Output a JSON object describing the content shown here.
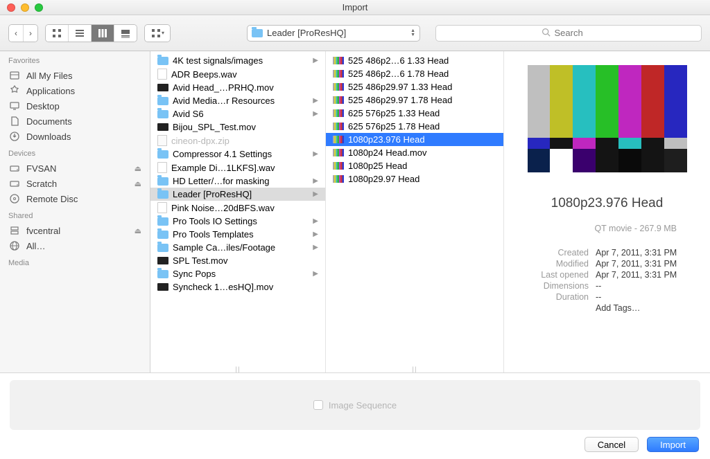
{
  "window": {
    "title": "Import"
  },
  "toolbar": {
    "location_label": "Leader [ProResHQ]",
    "search_placeholder": "Search"
  },
  "sidebar": {
    "groups": [
      {
        "label": "Favorites",
        "items": [
          {
            "icon": "all-my-files-icon",
            "label": "All My Files"
          },
          {
            "icon": "applications-icon",
            "label": "Applications"
          },
          {
            "icon": "desktop-icon",
            "label": "Desktop"
          },
          {
            "icon": "documents-icon",
            "label": "Documents"
          },
          {
            "icon": "downloads-icon",
            "label": "Downloads"
          }
        ]
      },
      {
        "label": "Devices",
        "items": [
          {
            "icon": "drive-icon",
            "label": "FVSAN",
            "eject": true
          },
          {
            "icon": "drive-icon",
            "label": "Scratch",
            "eject": true
          },
          {
            "icon": "disc-icon",
            "label": "Remote Disc"
          }
        ]
      },
      {
        "label": "Shared",
        "items": [
          {
            "icon": "server-icon",
            "label": "fvcentral",
            "eject": true
          },
          {
            "icon": "network-icon",
            "label": "All…"
          }
        ]
      },
      {
        "label": "Media",
        "items": []
      }
    ]
  },
  "column1": [
    {
      "type": "folder",
      "label": "4K test signals/images",
      "children": true
    },
    {
      "type": "wav",
      "label": "ADR Beeps.wav"
    },
    {
      "type": "mov",
      "label": "Avid Head_…PRHQ.mov"
    },
    {
      "type": "folder",
      "label": "Avid Media…r Resources",
      "children": true
    },
    {
      "type": "folder",
      "label": "Avid S6",
      "children": true
    },
    {
      "type": "mov",
      "label": "Bijou_SPL_Test.mov"
    },
    {
      "type": "zip",
      "label": "cineon-dpx.zip",
      "dim": true
    },
    {
      "type": "folder",
      "label": "Compressor 4.1 Settings",
      "children": true
    },
    {
      "type": "wav",
      "label": "Example Di…1LKFS].wav"
    },
    {
      "type": "folder",
      "label": "HD Letter/…for masking",
      "children": true
    },
    {
      "type": "folder",
      "label": "Leader [ProResHQ]",
      "children": true,
      "selected": true
    },
    {
      "type": "wav",
      "label": "Pink Noise…20dBFS.wav"
    },
    {
      "type": "folder",
      "label": "Pro Tools IO Settings",
      "children": true
    },
    {
      "type": "folder",
      "label": "Pro Tools Templates",
      "children": true
    },
    {
      "type": "folder",
      "label": "Sample Ca…iles/Footage",
      "children": true
    },
    {
      "type": "mov",
      "label": "SPL Test.mov"
    },
    {
      "type": "folder",
      "label": "Sync Pops",
      "children": true
    },
    {
      "type": "mov",
      "label": "Syncheck 1…esHQ].mov"
    }
  ],
  "column2": [
    {
      "type": "bars",
      "label": "525 486p2…6 1.33 Head"
    },
    {
      "type": "bars",
      "label": "525 486p2…6 1.78 Head"
    },
    {
      "type": "bars",
      "label": "525 486p29.97 1.33 Head"
    },
    {
      "type": "bars",
      "label": "525 486p29.97 1.78 Head"
    },
    {
      "type": "bars",
      "label": "625 576p25 1.33 Head"
    },
    {
      "type": "bars",
      "label": "625 576p25 1.78 Head"
    },
    {
      "type": "bars",
      "label": "1080p23.976 Head",
      "selected": true
    },
    {
      "type": "bars",
      "label": "1080p24 Head.mov"
    },
    {
      "type": "bars",
      "label": "1080p25 Head"
    },
    {
      "type": "bars",
      "label": "1080p29.97 Head"
    }
  ],
  "preview": {
    "title": "1080p23.976 Head",
    "kind": "QT movie - 267.9 MB",
    "rows": [
      {
        "k": "Created",
        "v": "Apr 7, 2011, 3:31 PM"
      },
      {
        "k": "Modified",
        "v": "Apr 7, 2011, 3:31 PM"
      },
      {
        "k": "Last opened",
        "v": "Apr 7, 2011, 3:31 PM"
      },
      {
        "k": "Dimensions",
        "v": "--"
      },
      {
        "k": "Duration",
        "v": "--"
      }
    ],
    "add_tags": "Add Tags…"
  },
  "options": {
    "image_sequence": "Image Sequence"
  },
  "buttons": {
    "cancel": "Cancel",
    "import": "Import"
  }
}
